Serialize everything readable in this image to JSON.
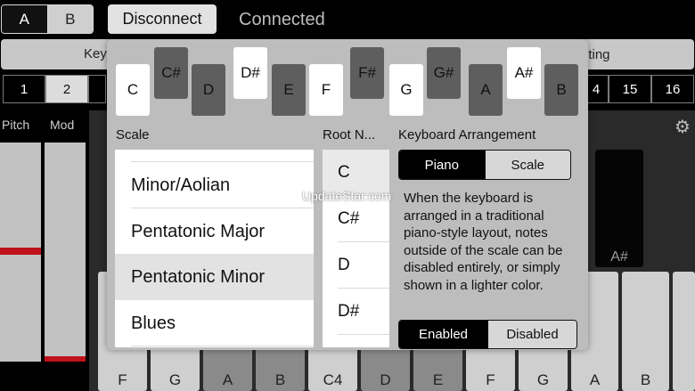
{
  "top": {
    "seg_a": "A",
    "seg_b": "B",
    "disconnect_label": "Disconnect",
    "status": "Connected"
  },
  "mode_bar": {
    "left_label": "Key",
    "right_label": "uting"
  },
  "channels": [
    "1",
    "2",
    "4",
    "15",
    "16"
  ],
  "side": {
    "pitch_label": "Pitch",
    "mod_label": "Mod"
  },
  "keyboard": {
    "visible_black_key": "A#",
    "white_keys": [
      "F",
      "G",
      "A",
      "B",
      "C4",
      "D",
      "E",
      "F",
      "G",
      "A",
      "B"
    ]
  },
  "popover": {
    "root_keys": [
      {
        "label": "C",
        "kind": "white"
      },
      {
        "label": "C#",
        "kind": "black"
      },
      {
        "label": "D",
        "kind": "dark"
      },
      {
        "label": "D#",
        "kind": "white-up"
      },
      {
        "label": "E",
        "kind": "dark"
      },
      {
        "label": "F",
        "kind": "white"
      },
      {
        "label": "F#",
        "kind": "black"
      },
      {
        "label": "G",
        "kind": "white"
      },
      {
        "label": "G#",
        "kind": "black"
      },
      {
        "label": "A",
        "kind": "dark"
      },
      {
        "label": "A#",
        "kind": "white-up"
      },
      {
        "label": "B",
        "kind": "dark"
      }
    ],
    "scale_title": "Scale",
    "root_title": "Root N...",
    "arrangement_title": "Keyboard Arrangement",
    "scales": [
      "Minor/Aolian",
      "Pentatonic Major",
      "Pentatonic Minor",
      "Blues"
    ],
    "selected_scale": "Pentatonic Minor",
    "roots": [
      "C",
      "C#",
      "D",
      "D#"
    ],
    "selected_root": "C",
    "arrangement": {
      "piano": "Piano",
      "scale": "Scale",
      "selected": "Piano"
    },
    "description": "When the keyboard is arranged in a traditional piano-style layout, notes outside of the scale can be disabled entirely, or simply shown in a lighter color.",
    "out_of_scale": {
      "enabled": "Enabled",
      "disabled": "Disabled",
      "selected": "Enabled"
    }
  },
  "watermark": "UpdateStar.com",
  "colors": {
    "slider_mark": "#c0121a",
    "popover_bg": "#bdbdbd",
    "selected_row": "#e2e2e2"
  }
}
